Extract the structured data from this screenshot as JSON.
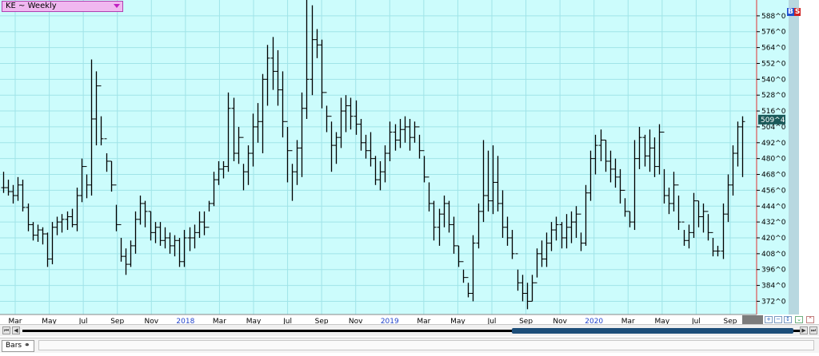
{
  "symbol": {
    "label": "KE ~ Weekly"
  },
  "badges": {
    "b": "B",
    "s": "S"
  },
  "status": {
    "tab_label": "Bars"
  },
  "colors": {
    "background": "#ccfcfc",
    "grid": "#a0e4e8",
    "bars": "#000000",
    "cursor_line": "#e03030",
    "year_label": "#2244cc",
    "price_tag_bg": "#1a5a5a",
    "price_tag_text": "#ffffff"
  },
  "chart_data": {
    "type": "ohlc_bars",
    "interval": "Weekly",
    "x_axis": {
      "labels": [
        "Mar",
        "May",
        "Jul",
        "Sep",
        "Nov",
        "2018",
        "Mar",
        "May",
        "Jul",
        "Sep",
        "Nov",
        "2019",
        "Mar",
        "May",
        "Jul",
        "Sep",
        "Nov",
        "2020",
        "Mar",
        "May",
        "Jul",
        "Sep"
      ],
      "year_labels": [
        "2018",
        "2019",
        "2020"
      ]
    },
    "y_axis": {
      "tick_labels": [
        "588^0",
        "576^0",
        "564^0",
        "552^0",
        "540^0",
        "528^0",
        "516^0",
        "504^0",
        "492^0",
        "480^0",
        "468^0",
        "456^0",
        "444^0",
        "432^0",
        "420^0",
        "408^0",
        "396^0",
        "384^0",
        "372^0"
      ],
      "ylim": [
        362,
        600
      ]
    },
    "last_price_label": "509^4",
    "bars": [
      [
        458,
        470,
        454,
        458
      ],
      [
        458,
        464,
        452,
        455
      ],
      [
        455,
        460,
        446,
        452
      ],
      [
        452,
        466,
        448,
        460
      ],
      [
        460,
        464,
        440,
        443
      ],
      [
        443,
        446,
        425,
        430
      ],
      [
        430,
        432,
        418,
        422
      ],
      [
        422,
        430,
        417,
        426
      ],
      [
        426,
        428,
        415,
        423
      ],
      [
        423,
        424,
        398,
        404
      ],
      [
        404,
        432,
        400,
        428
      ],
      [
        428,
        436,
        422,
        432
      ],
      [
        432,
        438,
        424,
        434
      ],
      [
        434,
        440,
        426,
        436
      ],
      [
        436,
        442,
        428,
        430
      ],
      [
        430,
        458,
        425,
        452
      ],
      [
        452,
        480,
        447,
        474
      ],
      [
        474,
        468,
        450,
        460
      ],
      [
        460,
        555,
        452,
        510
      ],
      [
        510,
        546,
        490,
        535
      ],
      [
        535,
        512,
        490,
        495
      ],
      [
        495,
        484,
        470,
        478
      ],
      [
        478,
        478,
        455,
        460
      ],
      [
        460,
        445,
        425,
        430
      ],
      [
        430,
        420,
        402,
        406
      ],
      [
        406,
        412,
        392,
        400
      ],
      [
        400,
        418,
        398,
        414
      ],
      [
        414,
        440,
        408,
        434
      ],
      [
        434,
        452,
        430,
        446
      ],
      [
        446,
        448,
        428,
        440
      ],
      [
        440,
        440,
        418,
        424
      ],
      [
        424,
        432,
        416,
        428
      ],
      [
        428,
        432,
        414,
        418
      ],
      [
        418,
        428,
        412,
        420
      ],
      [
        420,
        424,
        408,
        414
      ],
      [
        414,
        422,
        406,
        418
      ],
      [
        418,
        420,
        398,
        402
      ],
      [
        402,
        426,
        398,
        420
      ],
      [
        420,
        428,
        410,
        420
      ],
      [
        420,
        430,
        412,
        424
      ],
      [
        424,
        440,
        420,
        432
      ],
      [
        432,
        440,
        422,
        428
      ],
      [
        428,
        448,
        440,
        446
      ],
      [
        446,
        470,
        444,
        464
      ],
      [
        464,
        478,
        460,
        472
      ],
      [
        472,
        478,
        465,
        474
      ],
      [
        474,
        530,
        470,
        518
      ],
      [
        518,
        526,
        478,
        484
      ],
      [
        484,
        504,
        476,
        496
      ],
      [
        496,
        476,
        456,
        470
      ],
      [
        470,
        490,
        460,
        484
      ],
      [
        484,
        514,
        474,
        504
      ],
      [
        504,
        522,
        492,
        508
      ],
      [
        508,
        544,
        484,
        540
      ],
      [
        540,
        566,
        520,
        556
      ],
      [
        556,
        572,
        532,
        546
      ],
      [
        546,
        562,
        520,
        532
      ],
      [
        532,
        546,
        496,
        508
      ],
      [
        508,
        504,
        462,
        486
      ],
      [
        486,
        476,
        448,
        470
      ],
      [
        470,
        494,
        460,
        488
      ],
      [
        488,
        530,
        466,
        518
      ],
      [
        518,
        600,
        510,
        540
      ],
      [
        540,
        596,
        528,
        570
      ],
      [
        570,
        578,
        556,
        566
      ],
      [
        566,
        570,
        518,
        530
      ],
      [
        530,
        520,
        500,
        512
      ],
      [
        512,
        508,
        470,
        490
      ],
      [
        490,
        500,
        476,
        496
      ],
      [
        496,
        526,
        488,
        516
      ],
      [
        516,
        528,
        500,
        520
      ],
      [
        520,
        526,
        502,
        512
      ],
      [
        512,
        524,
        498,
        506
      ],
      [
        506,
        510,
        486,
        492
      ],
      [
        492,
        498,
        480,
        486
      ],
      [
        486,
        500,
        474,
        480
      ],
      [
        480,
        482,
        460,
        464
      ],
      [
        464,
        478,
        456,
        470
      ],
      [
        470,
        490,
        462,
        484
      ],
      [
        484,
        508,
        478,
        500
      ],
      [
        500,
        506,
        486,
        494
      ],
      [
        494,
        510,
        488,
        502
      ],
      [
        502,
        512,
        492,
        504
      ],
      [
        504,
        510,
        486,
        496
      ],
      [
        496,
        508,
        492,
        504
      ],
      [
        504,
        498,
        480,
        486
      ],
      [
        486,
        482,
        462,
        466
      ],
      [
        466,
        462,
        440,
        446
      ],
      [
        446,
        448,
        418,
        428
      ],
      [
        428,
        442,
        414,
        438
      ],
      [
        438,
        452,
        428,
        446
      ],
      [
        446,
        448,
        424,
        430
      ],
      [
        430,
        436,
        408,
        414
      ],
      [
        414,
        414,
        398,
        402
      ],
      [
        402,
        396,
        386,
        390
      ],
      [
        390,
        386,
        375,
        378
      ],
      [
        378,
        422,
        372,
        416
      ],
      [
        416,
        446,
        412,
        440
      ],
      [
        440,
        494,
        432,
        452
      ],
      [
        452,
        486,
        440,
        448
      ],
      [
        448,
        490,
        438,
        462
      ],
      [
        462,
        482,
        440,
        446
      ],
      [
        446,
        456,
        420,
        428
      ],
      [
        428,
        436,
        414,
        420
      ],
      [
        420,
        426,
        404,
        408
      ],
      [
        408,
        396,
        380,
        386
      ],
      [
        386,
        392,
        372,
        378
      ],
      [
        378,
        386,
        366,
        372
      ],
      [
        372,
        392,
        372,
        386
      ],
      [
        386,
        412,
        390,
        408
      ],
      [
        408,
        418,
        398,
        404
      ],
      [
        404,
        424,
        398,
        416
      ],
      [
        416,
        432,
        410,
        426
      ],
      [
        426,
        436,
        418,
        430
      ],
      [
        430,
        432,
        412,
        420
      ],
      [
        420,
        438,
        412,
        428
      ],
      [
        428,
        440,
        416,
        432
      ],
      [
        432,
        444,
        420,
        438
      ],
      [
        438,
        424,
        410,
        416
      ],
      [
        416,
        460,
        414,
        454
      ],
      [
        454,
        486,
        448,
        480
      ],
      [
        480,
        498,
        468,
        490
      ],
      [
        490,
        502,
        478,
        494
      ],
      [
        494,
        494,
        470,
        478
      ],
      [
        478,
        486,
        462,
        472
      ],
      [
        472,
        480,
        458,
        466
      ],
      [
        466,
        472,
        446,
        456
      ],
      [
        456,
        450,
        436,
        440
      ],
      [
        440,
        440,
        428,
        432
      ],
      [
        432,
        494,
        426,
        480
      ],
      [
        480,
        504,
        472,
        496
      ],
      [
        496,
        498,
        474,
        482
      ],
      [
        482,
        502,
        470,
        488
      ],
      [
        488,
        496,
        466,
        474
      ],
      [
        474,
        506,
        468,
        500
      ],
      [
        500,
        472,
        446,
        452
      ],
      [
        452,
        458,
        438,
        446
      ],
      [
        446,
        470,
        440,
        460
      ],
      [
        460,
        452,
        426,
        432
      ],
      [
        432,
        426,
        414,
        418
      ],
      [
        418,
        430,
        412,
        424
      ],
      [
        424,
        454,
        420,
        448
      ],
      [
        448,
        448,
        428,
        436
      ],
      [
        436,
        446,
        424,
        440
      ],
      [
        440,
        438,
        418,
        424
      ],
      [
        424,
        420,
        406,
        410
      ],
      [
        410,
        414,
        406,
        410
      ],
      [
        410,
        446,
        404,
        438
      ],
      [
        438,
        468,
        432,
        460
      ],
      [
        460,
        490,
        452,
        484
      ],
      [
        484,
        508,
        474,
        504
      ],
      [
        504,
        512,
        466,
        508
      ]
    ]
  }
}
